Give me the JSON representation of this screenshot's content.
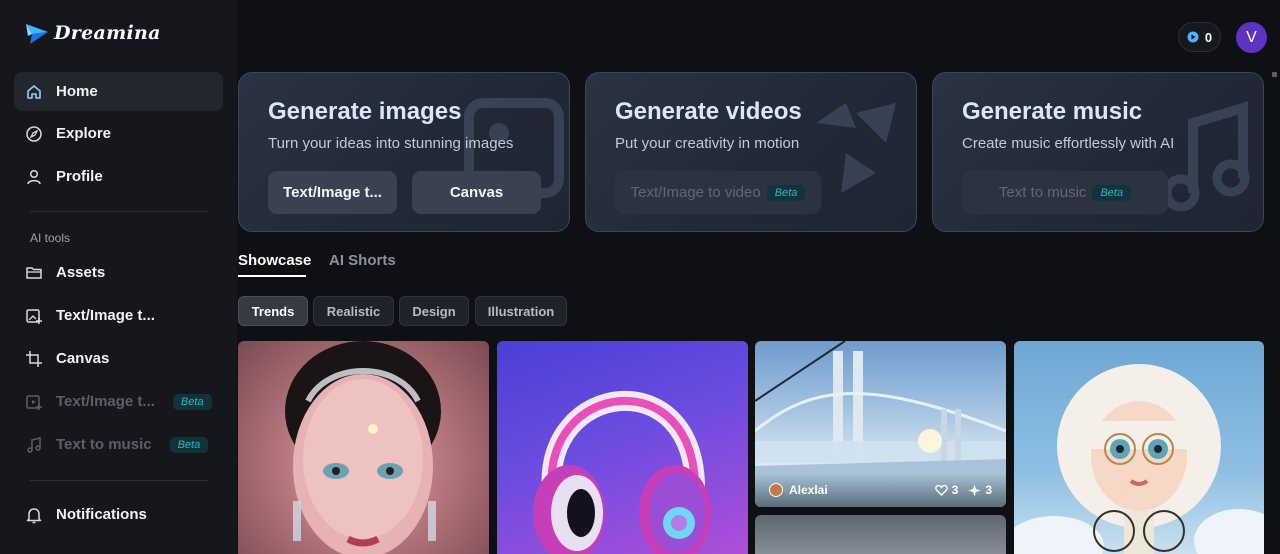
{
  "app": {
    "name": "Dreamina"
  },
  "sidebar": {
    "nav": [
      {
        "label": "Home",
        "icon": "home-icon"
      },
      {
        "label": "Explore",
        "icon": "compass-icon"
      },
      {
        "label": "Profile",
        "icon": "user-icon"
      }
    ],
    "section_label": "AI tools",
    "tools": [
      {
        "label": "Assets",
        "icon": "folder-icon"
      },
      {
        "label": "Text/Image t...",
        "icon": "image-plus-icon"
      },
      {
        "label": "Canvas",
        "icon": "crop-icon"
      },
      {
        "label": "Text/Image t...",
        "icon": "video-plus-icon",
        "badge": "Beta",
        "disabled": true
      },
      {
        "label": "Text to music",
        "icon": "music-icon",
        "badge": "Beta",
        "disabled": true
      }
    ],
    "notifications": {
      "label": "Notifications",
      "icon": "bell-icon"
    }
  },
  "header": {
    "credits": "0",
    "avatar_initial": "V"
  },
  "hero_cards": [
    {
      "title": "Generate images",
      "subtitle": "Turn your ideas into stunning images",
      "buttons": [
        {
          "label": "Text/Image t..."
        },
        {
          "label": "Canvas"
        }
      ]
    },
    {
      "title": "Generate videos",
      "subtitle": "Put your creativity in motion",
      "buttons": [
        {
          "label": "Text/Image to video",
          "badge": "Beta"
        }
      ]
    },
    {
      "title": "Generate music",
      "subtitle": "Create music effortlessly with AI",
      "buttons": [
        {
          "label": "Text to music",
          "badge": "Beta"
        }
      ]
    }
  ],
  "tabs": [
    {
      "label": "Showcase",
      "active": true
    },
    {
      "label": "AI Shorts",
      "active": false
    }
  ],
  "filters": [
    {
      "label": "Trends",
      "active": true
    },
    {
      "label": "Realistic"
    },
    {
      "label": "Design"
    },
    {
      "label": "Illustration"
    }
  ],
  "gallery": {
    "bridge_tile": {
      "author": "Alexlai",
      "likes": "3",
      "remixes": "3"
    }
  },
  "colors": {
    "accent": "#5b34c4",
    "beta": "#23b8c9",
    "background": "#0f1014"
  }
}
